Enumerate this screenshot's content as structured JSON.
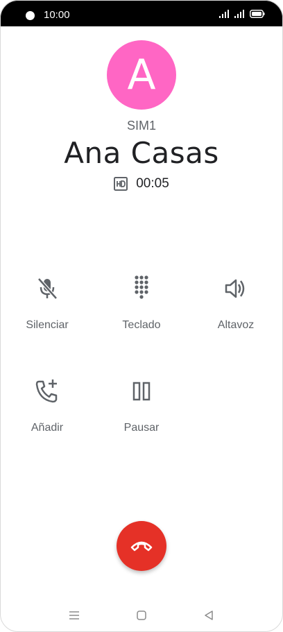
{
  "status_bar": {
    "time": "10:00",
    "icons": [
      "dot-icon",
      "signal-icon",
      "signal-icon",
      "battery-icon"
    ]
  },
  "call": {
    "avatar_letter": "A",
    "avatar_color": "#ff66c4",
    "sim": "SIM1",
    "contact_name": "Ana Casas",
    "hd_icon": "hd-icon",
    "duration": "00:05"
  },
  "controls": [
    {
      "label": "Silenciar",
      "icon": "mic-off-icon"
    },
    {
      "label": "Teclado",
      "icon": "dialpad-icon"
    },
    {
      "label": "Altavoz",
      "icon": "speaker-icon"
    },
    {
      "label": "Añadir",
      "icon": "add-call-icon"
    },
    {
      "label": "Pausar",
      "icon": "pause-icon"
    }
  ],
  "end_call": {
    "icon": "end-call-icon",
    "color": "#e53127"
  },
  "nav_bar": {
    "icons": [
      "menu-icon",
      "home-icon",
      "back-icon"
    ]
  }
}
